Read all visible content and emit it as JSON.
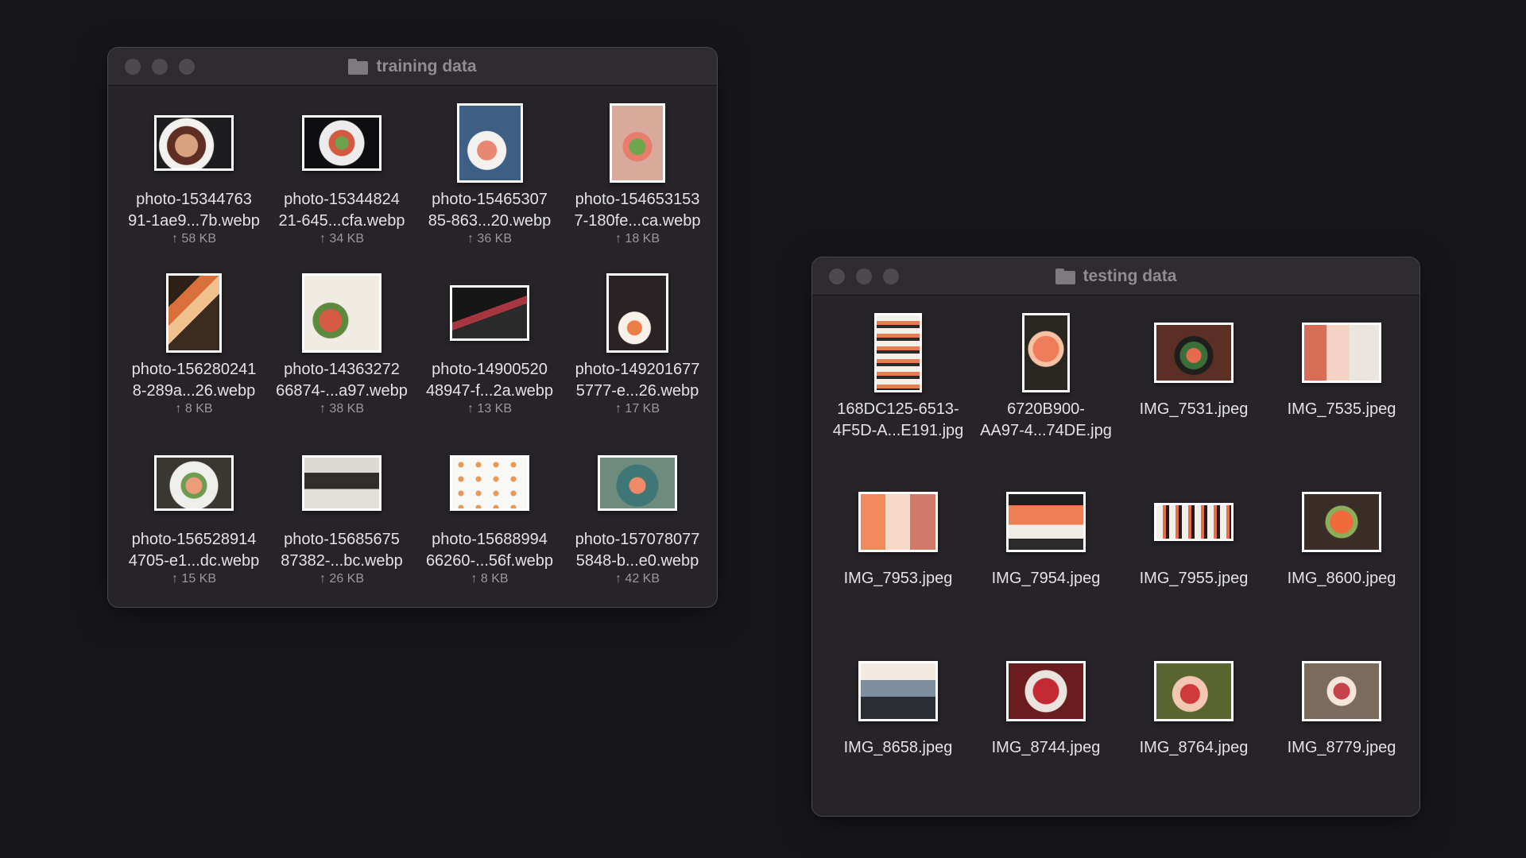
{
  "windows": {
    "training": {
      "title": "training data",
      "items": [
        {
          "name": "photo-15344763\n91-1ae9...7b.webp",
          "size": "↑ 58 KB"
        },
        {
          "name": "photo-15344824\n21-645...cfa.webp",
          "size": "↑ 34 KB"
        },
        {
          "name": "photo-15465307\n85-863...20.webp",
          "size": "↑ 36 KB"
        },
        {
          "name": "photo-154653153\n7-180fe...ca.webp",
          "size": "↑ 18 KB"
        },
        {
          "name": "photo-156280241\n8-289a...26.webp",
          "size": "↑ 8 KB"
        },
        {
          "name": "photo-14363272\n66874-...a97.webp",
          "size": "↑ 38 KB"
        },
        {
          "name": "photo-14900520\n48947-f...2a.webp",
          "size": "↑ 13 KB"
        },
        {
          "name": "photo-149201677\n5777-e...26.webp",
          "size": "↑ 17 KB"
        },
        {
          "name": "photo-156528914\n4705-e1...dc.webp",
          "size": "↑ 15 KB"
        },
        {
          "name": "photo-15685675\n87382-...bc.webp",
          "size": "↑ 26 KB"
        },
        {
          "name": "photo-15688994\n66260-...56f.webp",
          "size": "↑ 8 KB"
        },
        {
          "name": "photo-157078077\n5848-b...e0.webp",
          "size": "↑ 42 KB"
        }
      ]
    },
    "testing": {
      "title": "testing data",
      "items": [
        {
          "name": "168DC125-6513-\n4F5D-A...E191.jpg"
        },
        {
          "name": "6720B900-\nAA97-4...74DE.jpg"
        },
        {
          "name": "IMG_7531.jpeg"
        },
        {
          "name": "IMG_7535.jpeg"
        },
        {
          "name": "IMG_7953.jpeg"
        },
        {
          "name": "IMG_7954.jpeg"
        },
        {
          "name": "IMG_7955.jpeg"
        },
        {
          "name": "IMG_8600.jpeg"
        },
        {
          "name": "IMG_8658.jpeg"
        },
        {
          "name": "IMG_8744.jpeg"
        },
        {
          "name": "IMG_8764.jpeg"
        },
        {
          "name": "IMG_8779.jpeg"
        }
      ]
    }
  },
  "icons": {
    "title_icon": "folder-icon",
    "window_controls": [
      "close-button",
      "minimize-button",
      "zoom-button"
    ],
    "upload_indicator": "↑"
  },
  "colors": {
    "desktop": "#18181b",
    "window_bg": "#262428",
    "titlebar": "#2e2c31",
    "thumbnail_border": "#ffffff"
  }
}
